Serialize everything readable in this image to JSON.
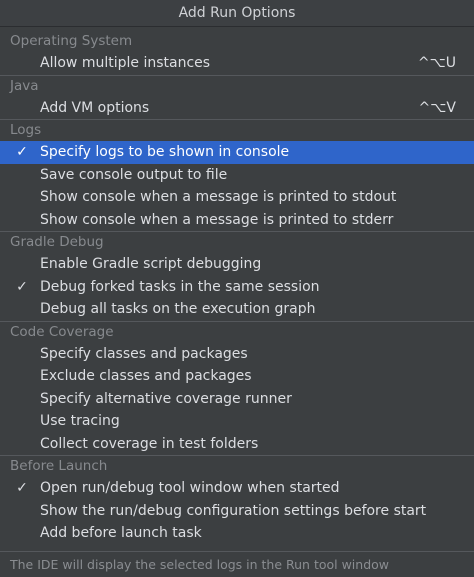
{
  "popup": {
    "title": "Add Run Options",
    "footer_text": "The IDE will display the selected logs in the Run tool window"
  },
  "groups": [
    {
      "header": "Operating System",
      "items": [
        {
          "label": "Allow multiple instances",
          "shortcut": "^⌥U",
          "checked": false,
          "selected": false
        }
      ]
    },
    {
      "header": "Java",
      "items": [
        {
          "label": "Add VM options",
          "shortcut": "^⌥V",
          "checked": false,
          "selected": false
        }
      ]
    },
    {
      "header": "Logs",
      "items": [
        {
          "label": "Specify logs to be shown in console",
          "shortcut": "",
          "checked": true,
          "selected": true
        },
        {
          "label": "Save console output to file",
          "shortcut": "",
          "checked": false,
          "selected": false
        },
        {
          "label": "Show console when a message is printed to stdout",
          "shortcut": "",
          "checked": false,
          "selected": false
        },
        {
          "label": "Show console when a message is printed to stderr",
          "shortcut": "",
          "checked": false,
          "selected": false
        }
      ]
    },
    {
      "header": "Gradle Debug",
      "items": [
        {
          "label": "Enable Gradle script debugging",
          "shortcut": "",
          "checked": false,
          "selected": false
        },
        {
          "label": "Debug forked tasks in the same session",
          "shortcut": "",
          "checked": true,
          "selected": false
        },
        {
          "label": "Debug all tasks on the execution graph",
          "shortcut": "",
          "checked": false,
          "selected": false
        }
      ]
    },
    {
      "header": "Code Coverage",
      "items": [
        {
          "label": "Specify classes and packages",
          "shortcut": "",
          "checked": false,
          "selected": false
        },
        {
          "label": "Exclude classes and packages",
          "shortcut": "",
          "checked": false,
          "selected": false
        },
        {
          "label": "Specify alternative coverage runner",
          "shortcut": "",
          "checked": false,
          "selected": false
        },
        {
          "label": "Use tracing",
          "shortcut": "",
          "checked": false,
          "selected": false
        },
        {
          "label": "Collect coverage in test folders",
          "shortcut": "",
          "checked": false,
          "selected": false
        }
      ]
    },
    {
      "header": "Before Launch",
      "items": [
        {
          "label": "Open run/debug tool window when started",
          "shortcut": "",
          "checked": true,
          "selected": false
        },
        {
          "label": "Show the run/debug configuration settings before start",
          "shortcut": "",
          "checked": false,
          "selected": false
        },
        {
          "label": "Add before launch task",
          "shortcut": "",
          "checked": false,
          "selected": false
        }
      ]
    }
  ],
  "icons": {
    "check": "checkmark-icon"
  },
  "colors": {
    "background": "#3c3f41",
    "selection": "#2f65ca",
    "header_text": "#878a8e",
    "item_text": "#dcdee2"
  }
}
